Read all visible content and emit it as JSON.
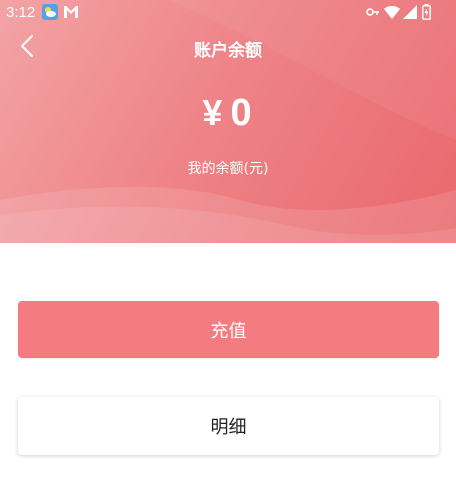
{
  "status_bar": {
    "time": "3:12",
    "icons": [
      "weather-icon",
      "gmail-icon",
      "vpn-key-icon",
      "wifi-icon",
      "signal-icon",
      "battery-charging-icon"
    ]
  },
  "header": {
    "title": "账户余额",
    "back_icon": "chevron-left-icon",
    "currency_symbol": "¥",
    "balance": "0",
    "balance_label": "我的余额(元)"
  },
  "actions": {
    "recharge_label": "充值",
    "detail_label": "明细"
  },
  "colors": {
    "header_gradient_start": "#f3a3a6",
    "header_gradient_end": "#e9686d",
    "recharge_button": "#f47b7f",
    "detail_button": "#ffffff",
    "header_text": "#ffffff"
  }
}
